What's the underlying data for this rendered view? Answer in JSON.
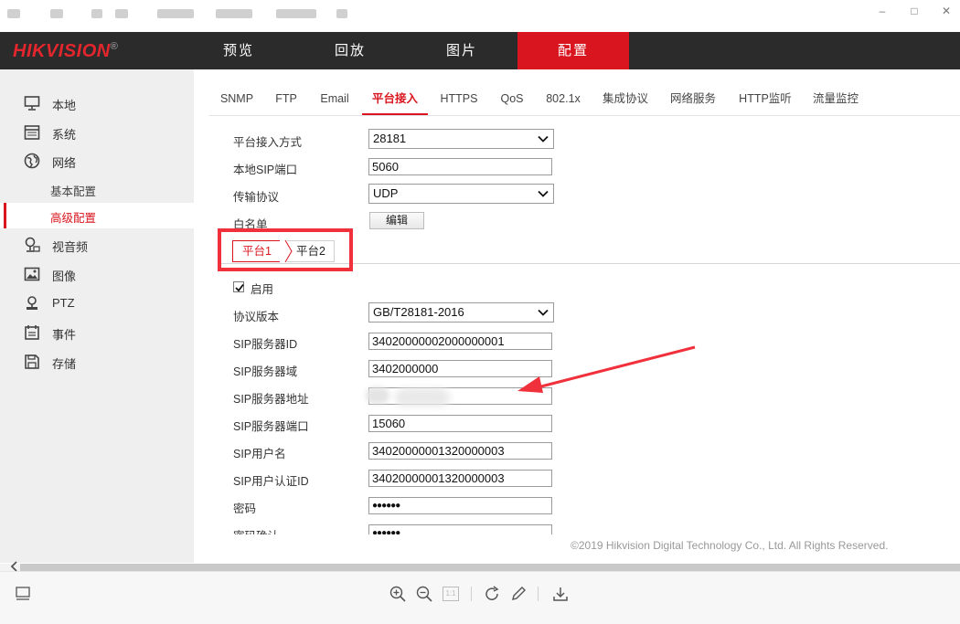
{
  "header": {
    "logo_text": "HIKVISION",
    "logo_mark": "®",
    "nav": [
      "预览",
      "回放",
      "图片",
      "配置"
    ],
    "active_nav": "配置",
    "accent_color": "#d9161f"
  },
  "sidebar": {
    "items": [
      {
        "label": "本地",
        "icon": "monitor-icon"
      },
      {
        "label": "系统",
        "icon": "system-window-icon"
      },
      {
        "label": "网络",
        "icon": "globe-icon"
      },
      {
        "label": "视音频",
        "icon": "microphone-camera-icon"
      },
      {
        "label": "图像",
        "icon": "image-icon"
      },
      {
        "label": "PTZ",
        "icon": "ptz-camera-icon"
      },
      {
        "label": "事件",
        "icon": "calendar-icon"
      },
      {
        "label": "存储",
        "icon": "floppy-disk-icon"
      }
    ],
    "network_sub": [
      {
        "label": "基本配置"
      },
      {
        "label": "高级配置"
      }
    ],
    "active_sub": "高级配置"
  },
  "tabs": [
    "SNMP",
    "FTP",
    "Email",
    "平台接入",
    "HTTPS",
    "QoS",
    "802.1x",
    "集成协议",
    "网络服务",
    "HTTP监听",
    "流量监控"
  ],
  "active_tab": "平台接入",
  "form": {
    "access_mode": {
      "label": "平台接入方式",
      "value": "28181"
    },
    "local_sip_port": {
      "label": "本地SIP端口",
      "value": "5060"
    },
    "transport": {
      "label": "传输协议",
      "value": "UDP"
    },
    "whitelist": {
      "label": "白名单",
      "button": "编辑"
    }
  },
  "platform_tabs": [
    "平台1",
    "平台2"
  ],
  "active_platform": "平台1",
  "platform_form": {
    "enable": {
      "label": "启用",
      "checked": true
    },
    "protocol_version": {
      "label": "协议版本",
      "value": "GB/T28181-2016"
    },
    "sip_server_id": {
      "label": "SIP服务器ID",
      "value": "34020000002000000001"
    },
    "sip_server_domain": {
      "label": "SIP服务器域",
      "value": "3402000000"
    },
    "sip_server_address": {
      "label": "SIP服务器地址",
      "value": ""
    },
    "sip_server_port": {
      "label": "SIP服务器端口",
      "value": "15060"
    },
    "sip_username": {
      "label": "SIP用户名",
      "value": "34020000001320000003"
    },
    "sip_auth_id": {
      "label": "SIP用户认证ID",
      "value": "34020000001320000003"
    },
    "password": {
      "label": "密码",
      "value": "●●●●●●"
    },
    "password_confirm": {
      "label": "密码确认",
      "value": "●●●●●●"
    }
  },
  "footer": {
    "copyright": "©2019 Hikvision Digital Technology Co., Ltd. All Rights Reserved."
  },
  "viewer_toolbar": {
    "icons": [
      "thumbnail-icon",
      "zoom-in-icon",
      "zoom-out-icon",
      "actual-size-icon",
      "rotate-icon",
      "edit-pen-icon",
      "download-icon"
    ],
    "actual_size_label": "1:1"
  },
  "annotation_color": "#f0303a"
}
